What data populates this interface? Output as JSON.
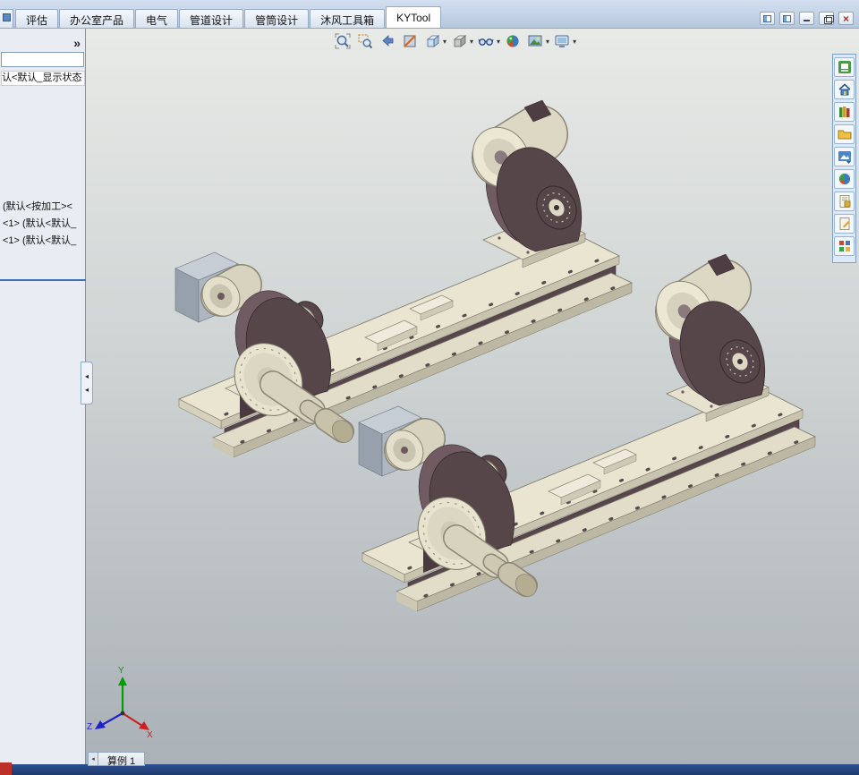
{
  "ribbon": {
    "tabs": [
      {
        "label": "评估",
        "active": false
      },
      {
        "label": "办公室产品",
        "active": false
      },
      {
        "label": "电气",
        "active": false
      },
      {
        "label": "管道设计",
        "active": false
      },
      {
        "label": "管筒设计",
        "active": false
      },
      {
        "label": "沐风工具箱",
        "active": false
      },
      {
        "label": "KYTool",
        "active": true
      }
    ],
    "window_controls": [
      {
        "name": "pane-toggle-left"
      },
      {
        "name": "pane-toggle-right"
      },
      {
        "name": "minimize"
      },
      {
        "name": "restore"
      },
      {
        "name": "close",
        "glyph": "×"
      }
    ]
  },
  "feature_panel": {
    "expand": "»",
    "filter_value": "",
    "root_item": "认<默认_显示状态",
    "items": [
      "(默认<按加工><",
      "<1> (默认<默认_",
      "<1> (默认<默认_"
    ],
    "splitter_arrows": "◂"
  },
  "headsup": {
    "icons": [
      {
        "name": "zoom-to-fit-icon",
        "dropdown": false
      },
      {
        "name": "zoom-to-area-icon",
        "dropdown": false
      },
      {
        "name": "previous-view-icon",
        "dropdown": false
      },
      {
        "name": "section-view-icon",
        "dropdown": false
      },
      {
        "name": "view-orientation-icon",
        "dropdown": true
      },
      {
        "name": "display-style-icon",
        "dropdown": true
      },
      {
        "name": "hide-show-items-icon",
        "dropdown": true
      },
      {
        "name": "edit-appearance-icon",
        "dropdown": false
      },
      {
        "name": "apply-scene-icon",
        "dropdown": true
      },
      {
        "name": "view-settings-icon",
        "dropdown": true
      }
    ],
    "dropdown_glyph": "▾"
  },
  "task_pane": {
    "icons": [
      {
        "name": "solidworks-resources-icon"
      },
      {
        "name": "home-icon"
      },
      {
        "name": "design-library-icon"
      },
      {
        "name": "file-explorer-icon"
      },
      {
        "name": "view-palette-icon"
      },
      {
        "name": "appearances-scenes-icon"
      },
      {
        "name": "custom-properties-icon"
      },
      {
        "name": "forum-icon"
      },
      {
        "name": "addins-icon"
      }
    ]
  },
  "viewport": {
    "model": "two pipe welding rotator assemblies",
    "triad": {
      "x": "X",
      "y": "Y",
      "z": "Z"
    }
  },
  "bottom": {
    "model_tab": "算例 1",
    "tab_scroll_glyph": "◂"
  },
  "colors": {
    "beam_cream": "#eae5d1",
    "web_dark": "#57464b",
    "bracket_dark": "#564549",
    "motor_gray": "#aeb6bf",
    "viewport_top": "#e8eae7",
    "viewport_bottom": "#aab1b7",
    "accent_blue": "#3f6fb5",
    "close_red": "#a03030",
    "axis_x_red": "#cc2020",
    "axis_y_green": "#00a000",
    "axis_z_blue": "#2020cc"
  }
}
